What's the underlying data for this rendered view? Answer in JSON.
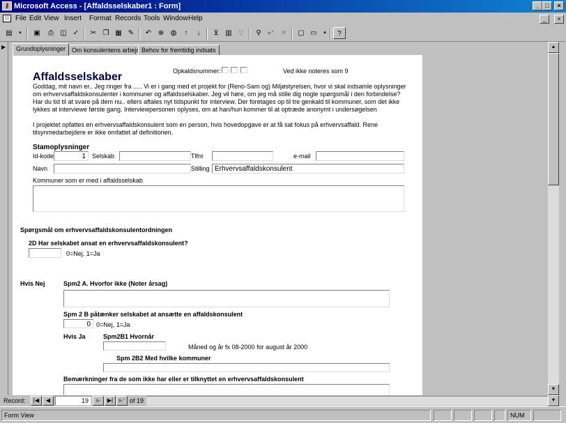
{
  "window": {
    "title": "Microsoft Access - [Affaldsselskaber1 : Form]",
    "min": "_",
    "max": "□",
    "close": "×"
  },
  "menu": [
    "File",
    "Edit",
    "View",
    "Insert",
    "Format",
    "Records",
    "Tools",
    "Window",
    "Help"
  ],
  "tabs": [
    "Grundoplysninger",
    "Om konsulentens arbejde",
    "Behov for fremtidig indsats"
  ],
  "form": {
    "heading": "Affaldsselskaber",
    "opkald_label": "Opkaldsnummer:",
    "opkald_note": "Ved ikke noteres som 9",
    "intro": "Goddag, mit navn er.. Jeg ringer fra ..... Vi er i gang med et projekt for (Reno-Sam og) Miljøstyrelsen, hvor vi skal indsamle oplysninger om erhvervsaffaldskonsulenter i kommuner og affaldsselskaber. Jeg vil høre, om jeg må stille dig nogle spørgsmål i den forbindelse? Har du tid til at svare på dem nu.. ellers aftales nyt tidspunkt for interview. Der foretages op til tre genkald til kommuner, som det ikke lykkes at interviewe første gang. Interviewpersonen oplyses, om at han/hun kommer til at optræde anonymt i undersøgelsen",
    "intro2": "I projektet opfattes en erhvervsaffaldskonsulent som en person, hvis hovedopgave er at få sat fokus på erhvervsaffald. Rene tilsynmedarbejdere er ikke omfattet af definitionen.",
    "stam_heading": "Stamoplysninger",
    "idkode_label": "Id-kode",
    "idkode_value": "1",
    "selskab_label": "Selskab",
    "tlf_label": "Tlfnr",
    "email_label": "e-mail",
    "navn_label": "Navn",
    "stilling_label": "Stilling",
    "stilling_value": "Erhvervsaffaldskonsulent",
    "kommuner_label": "Kommuner som er med i affaldsselskab",
    "q_heading": "Spørgsmål om erhvervsaffaldskonsulentordningen",
    "q2d": "2D Har selskabet ansat en erhvervsaffaldskonsulent?",
    "q2d_hint": "0=Nej, 1=Ja",
    "hvis_nej": "Hvis Nej",
    "spm2a": "Spm2 A. Hvorfor ikke (Noter årsag)",
    "spm2b": "Spm 2 B påtænker selskabet at ansætte en affaldskonsulent",
    "spm2b_value": "0",
    "spm2b_hint": "0=Nej, 1=Ja",
    "hvis_ja": "Hvis Ja",
    "spm2b1": "Spm2B1 Hvornår",
    "spm2b1_hint": "Måned og år fx 08-2000 for august år 2000",
    "spm2b2": "Spm 2B2 Med hvilke kommuner",
    "bemaerk": "Bemærkninger fra de som ikke har eller er tilknyttet en erhvervsaffaldskonsulent"
  },
  "record": {
    "label": "Record:",
    "current": "19",
    "of": "of 19"
  },
  "status": {
    "left": "Form View",
    "num": "NUM"
  }
}
